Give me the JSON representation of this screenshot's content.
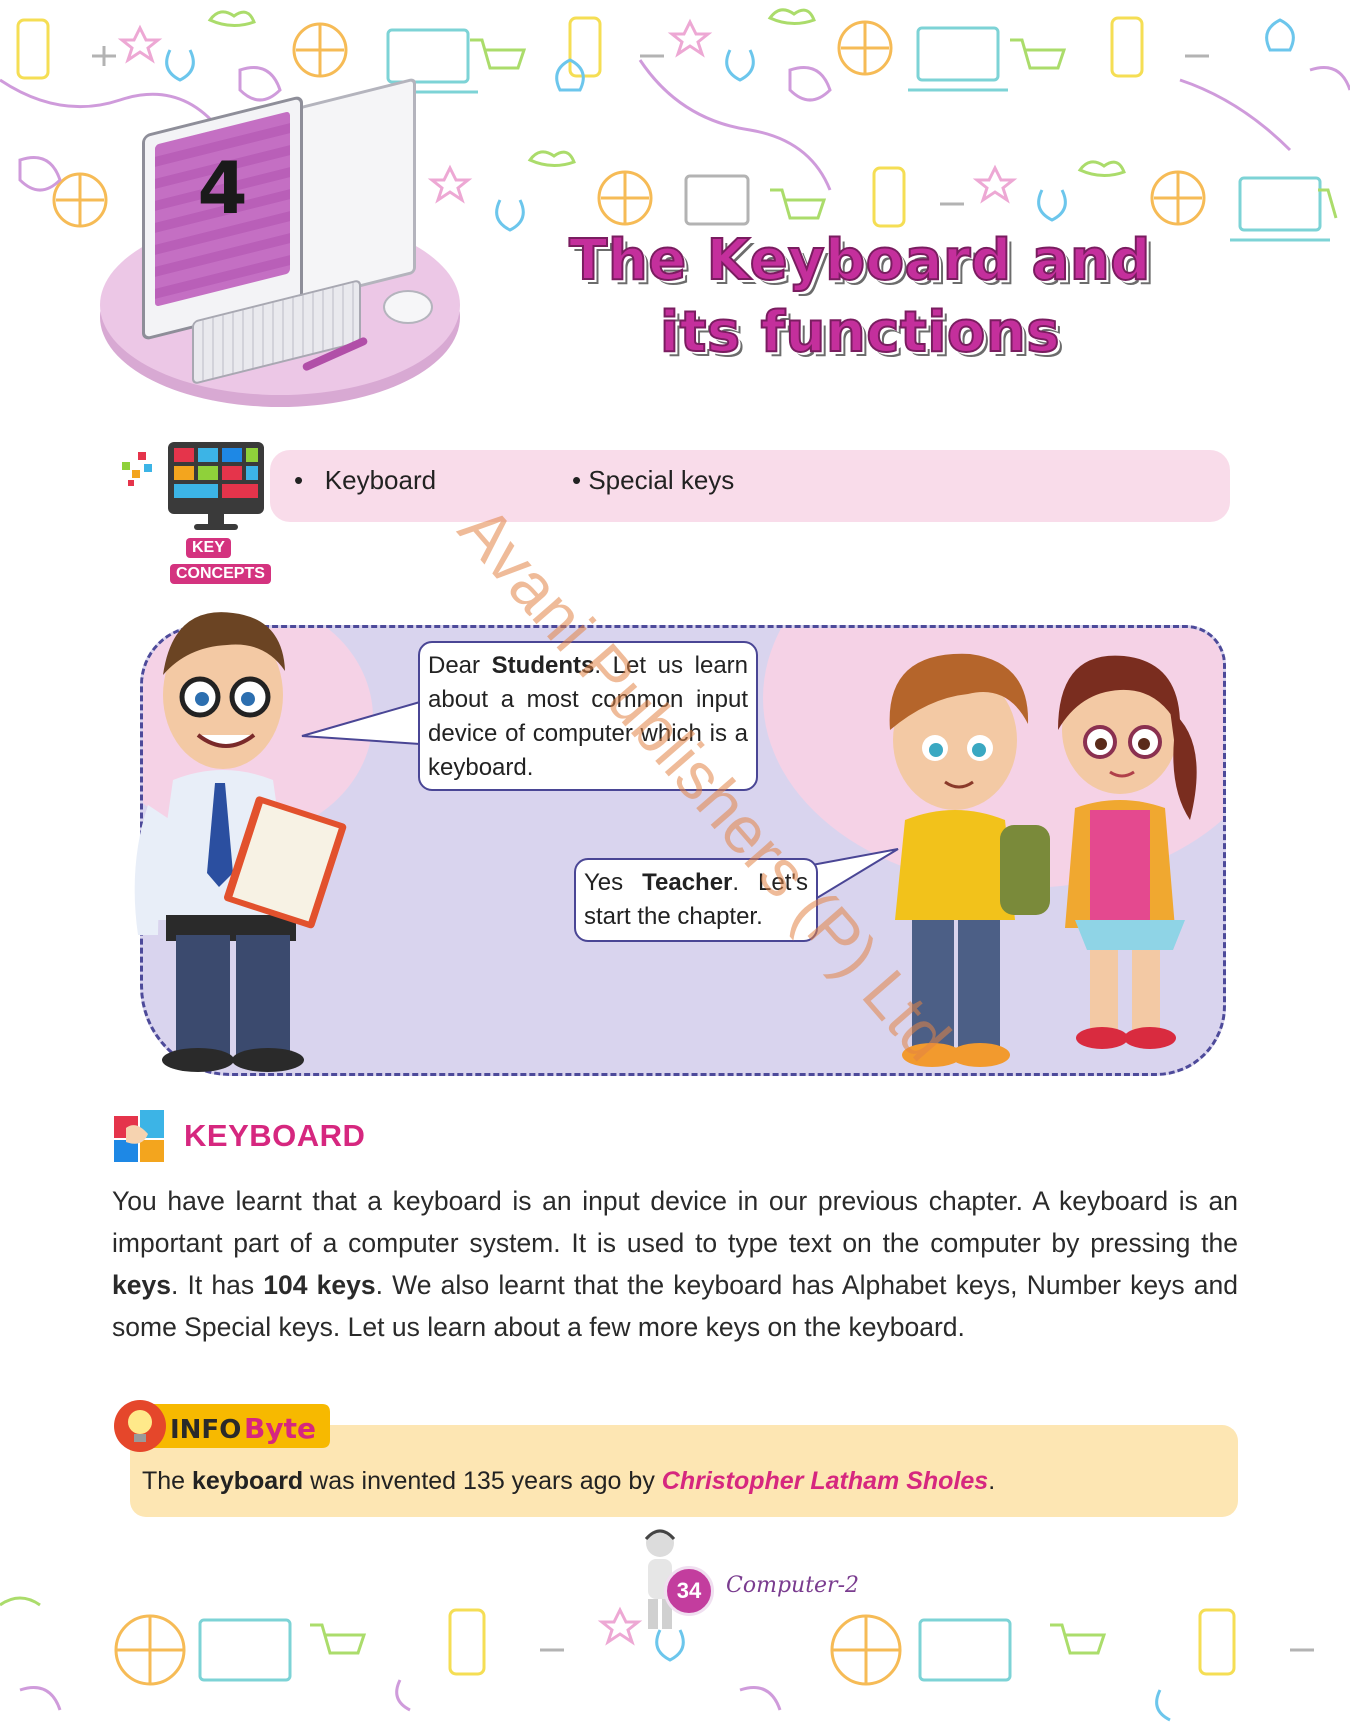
{
  "chapter": {
    "number": "4",
    "title": "The Keyboard and its functions"
  },
  "key_concepts": {
    "label_top": "KEY",
    "label_bottom": "CONCEPTS",
    "items": [
      "Keyboard",
      "Special keys"
    ]
  },
  "dialogue": {
    "teacher": {
      "greeting": "Dear ",
      "emphasis": "Students",
      "text": ". Let us learn about a most common input device of computer which is a keyboard."
    },
    "students": {
      "prefix": "Yes ",
      "emphasis": "Teacher",
      "text": ". Let's start the chapter."
    }
  },
  "watermark": "Avani Publishers (P) Ltd",
  "section": {
    "heading": "KEYBOARD",
    "para_1": "You have learnt that a keyboard is an input device in our previous chapter. A keyboard is an important part of a computer system. It is used to type text on the computer by pressing the ",
    "bold_1": "keys",
    "para_2": ". It has ",
    "bold_2": "104 keys",
    "para_3": ". We also learnt that the keyboard has Alphabet keys, Number keys and some Special keys. Let us learn about a few more keys on the keyboard."
  },
  "info_byte": {
    "label_info": "INFO",
    "label_byte": "Byte",
    "text_before": "The ",
    "bold": "keyboard",
    "text_middle": " was invented 135 years ago by ",
    "name": "Christopher Latham Sholes",
    "text_after": "."
  },
  "footer": {
    "page_number": "34",
    "book": "Computer-2"
  },
  "colors": {
    "title_magenta": "#c42f9c",
    "heading_pink": "#d6277f",
    "concept_bar": "#f9dcea",
    "info_box": "#fde6b3",
    "scene_lavender": "#d9d4ee"
  }
}
